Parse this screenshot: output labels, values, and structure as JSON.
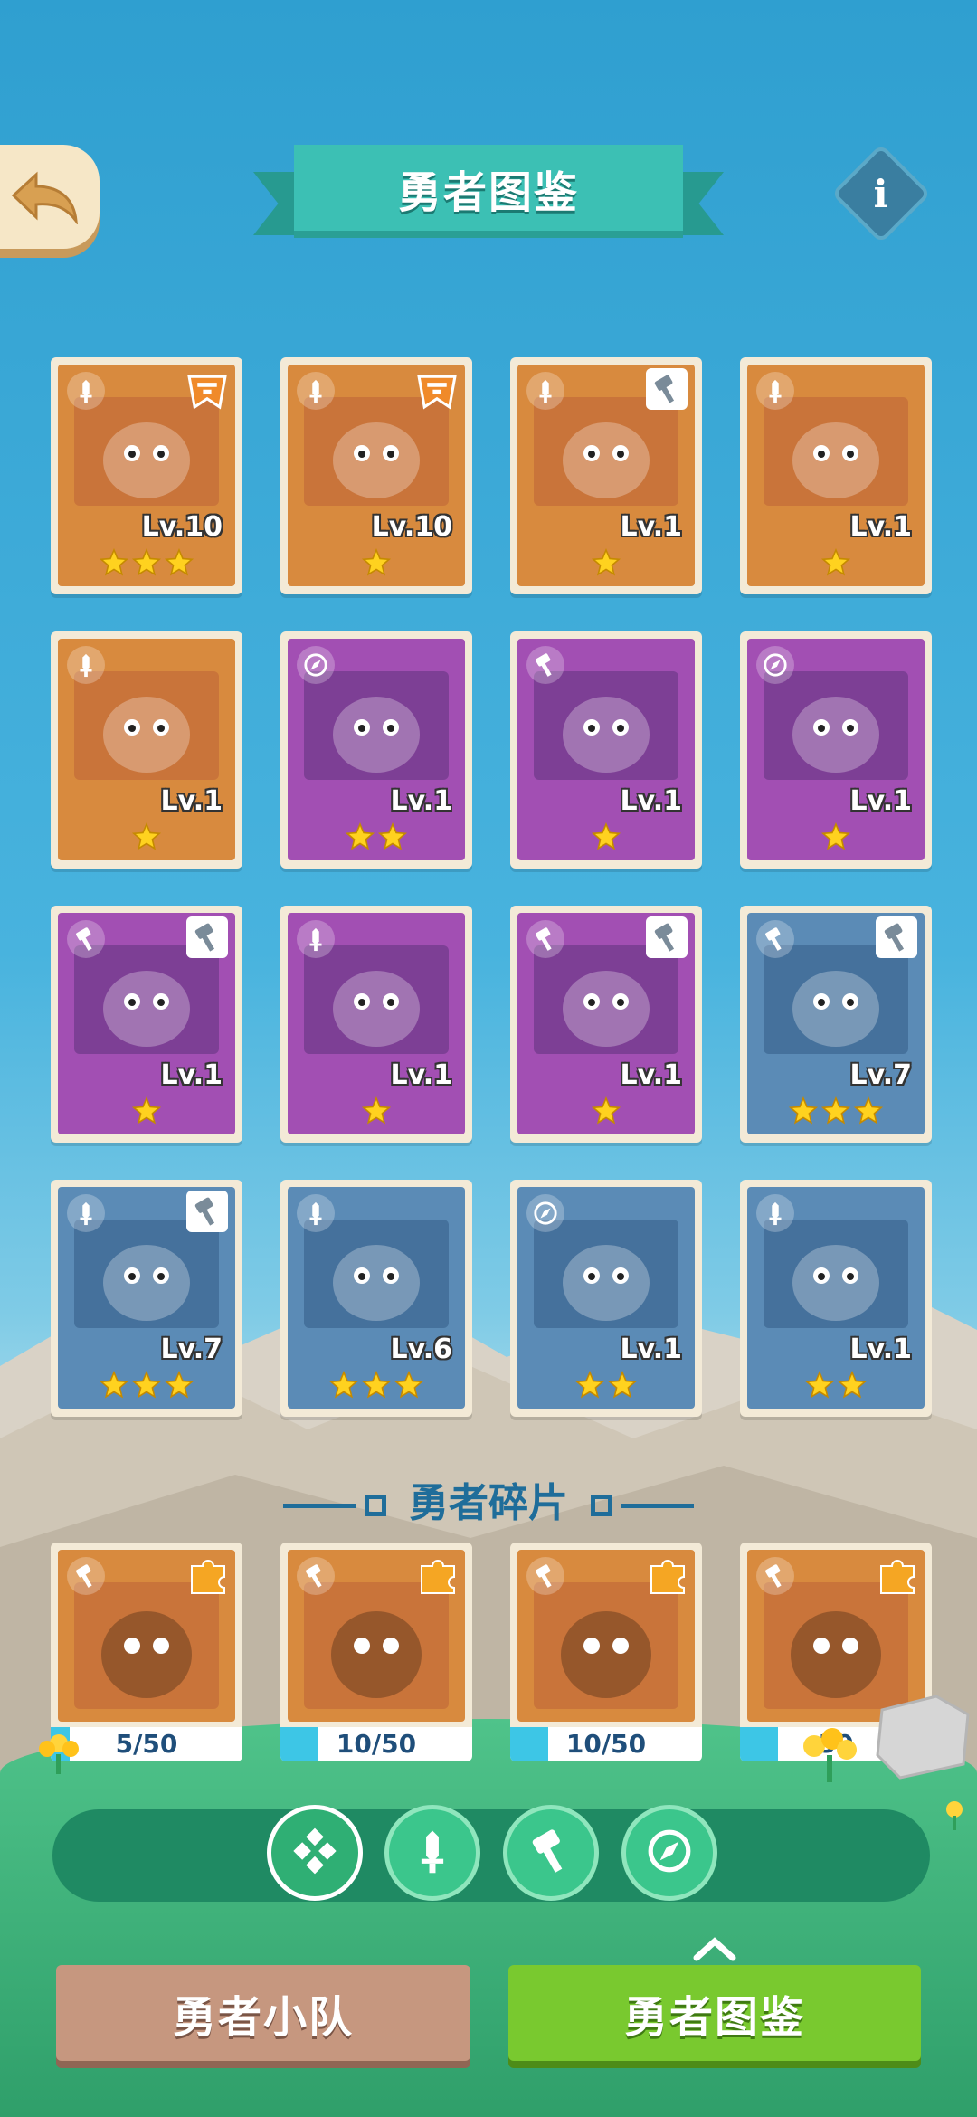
{
  "header": {
    "title": "勇者图鉴"
  },
  "heroes": [
    {
      "color": "orange",
      "level": "Lv.10",
      "stars": 3,
      "class_icon": "sword-icon",
      "corner": "badge-icon"
    },
    {
      "color": "orange",
      "level": "Lv.10",
      "stars": 1,
      "class_icon": "sword-icon",
      "corner": "badge-icon"
    },
    {
      "color": "orange",
      "level": "Lv.1",
      "stars": 1,
      "class_icon": "sword-icon",
      "corner": "hammer-icon"
    },
    {
      "color": "orange",
      "level": "Lv.1",
      "stars": 1,
      "class_icon": "sword-icon",
      "corner": ""
    },
    {
      "color": "orange",
      "level": "Lv.1",
      "stars": 1,
      "class_icon": "sword-icon",
      "corner": ""
    },
    {
      "color": "purple",
      "level": "Lv.1",
      "stars": 2,
      "class_icon": "compass-icon",
      "corner": ""
    },
    {
      "color": "purple",
      "level": "Lv.1",
      "stars": 1,
      "class_icon": "hammer-icon",
      "corner": ""
    },
    {
      "color": "purple",
      "level": "Lv.1",
      "stars": 1,
      "class_icon": "compass-icon",
      "corner": ""
    },
    {
      "color": "purple",
      "level": "Lv.1",
      "stars": 1,
      "class_icon": "hammer-icon",
      "corner": "hammer-icon"
    },
    {
      "color": "purple",
      "level": "Lv.1",
      "stars": 1,
      "class_icon": "sword-icon",
      "corner": ""
    },
    {
      "color": "purple",
      "level": "Lv.1",
      "stars": 1,
      "class_icon": "hammer-icon",
      "corner": "hammer-icon"
    },
    {
      "color": "blue",
      "level": "Lv.7",
      "stars": 3,
      "class_icon": "hammer-icon",
      "corner": "hammer-icon"
    },
    {
      "color": "blue",
      "level": "Lv.7",
      "stars": 3,
      "class_icon": "sword-icon",
      "corner": "hammer-icon"
    },
    {
      "color": "blue",
      "level": "Lv.6",
      "stars": 3,
      "class_icon": "sword-icon",
      "corner": ""
    },
    {
      "color": "blue",
      "level": "Lv.1",
      "stars": 2,
      "class_icon": "compass-icon",
      "corner": ""
    },
    {
      "color": "blue",
      "level": "Lv.1",
      "stars": 2,
      "class_icon": "sword-icon",
      "corner": ""
    }
  ],
  "fragments": {
    "title": "勇者碎片",
    "items": [
      {
        "progress_text": "5/50",
        "fraction": 0.1
      },
      {
        "progress_text": "10/50",
        "fraction": 0.2
      },
      {
        "progress_text": "10/50",
        "fraction": 0.2
      },
      {
        "progress_text": "50",
        "fraction": 0.2
      }
    ]
  },
  "filters": [
    {
      "icon": "all-icon",
      "active": true
    },
    {
      "icon": "sword-icon",
      "active": false
    },
    {
      "icon": "hammer-icon",
      "active": false
    },
    {
      "icon": "compass-icon",
      "active": false
    }
  ],
  "tabs": {
    "team": "勇者小队",
    "dex": "勇者图鉴"
  }
}
